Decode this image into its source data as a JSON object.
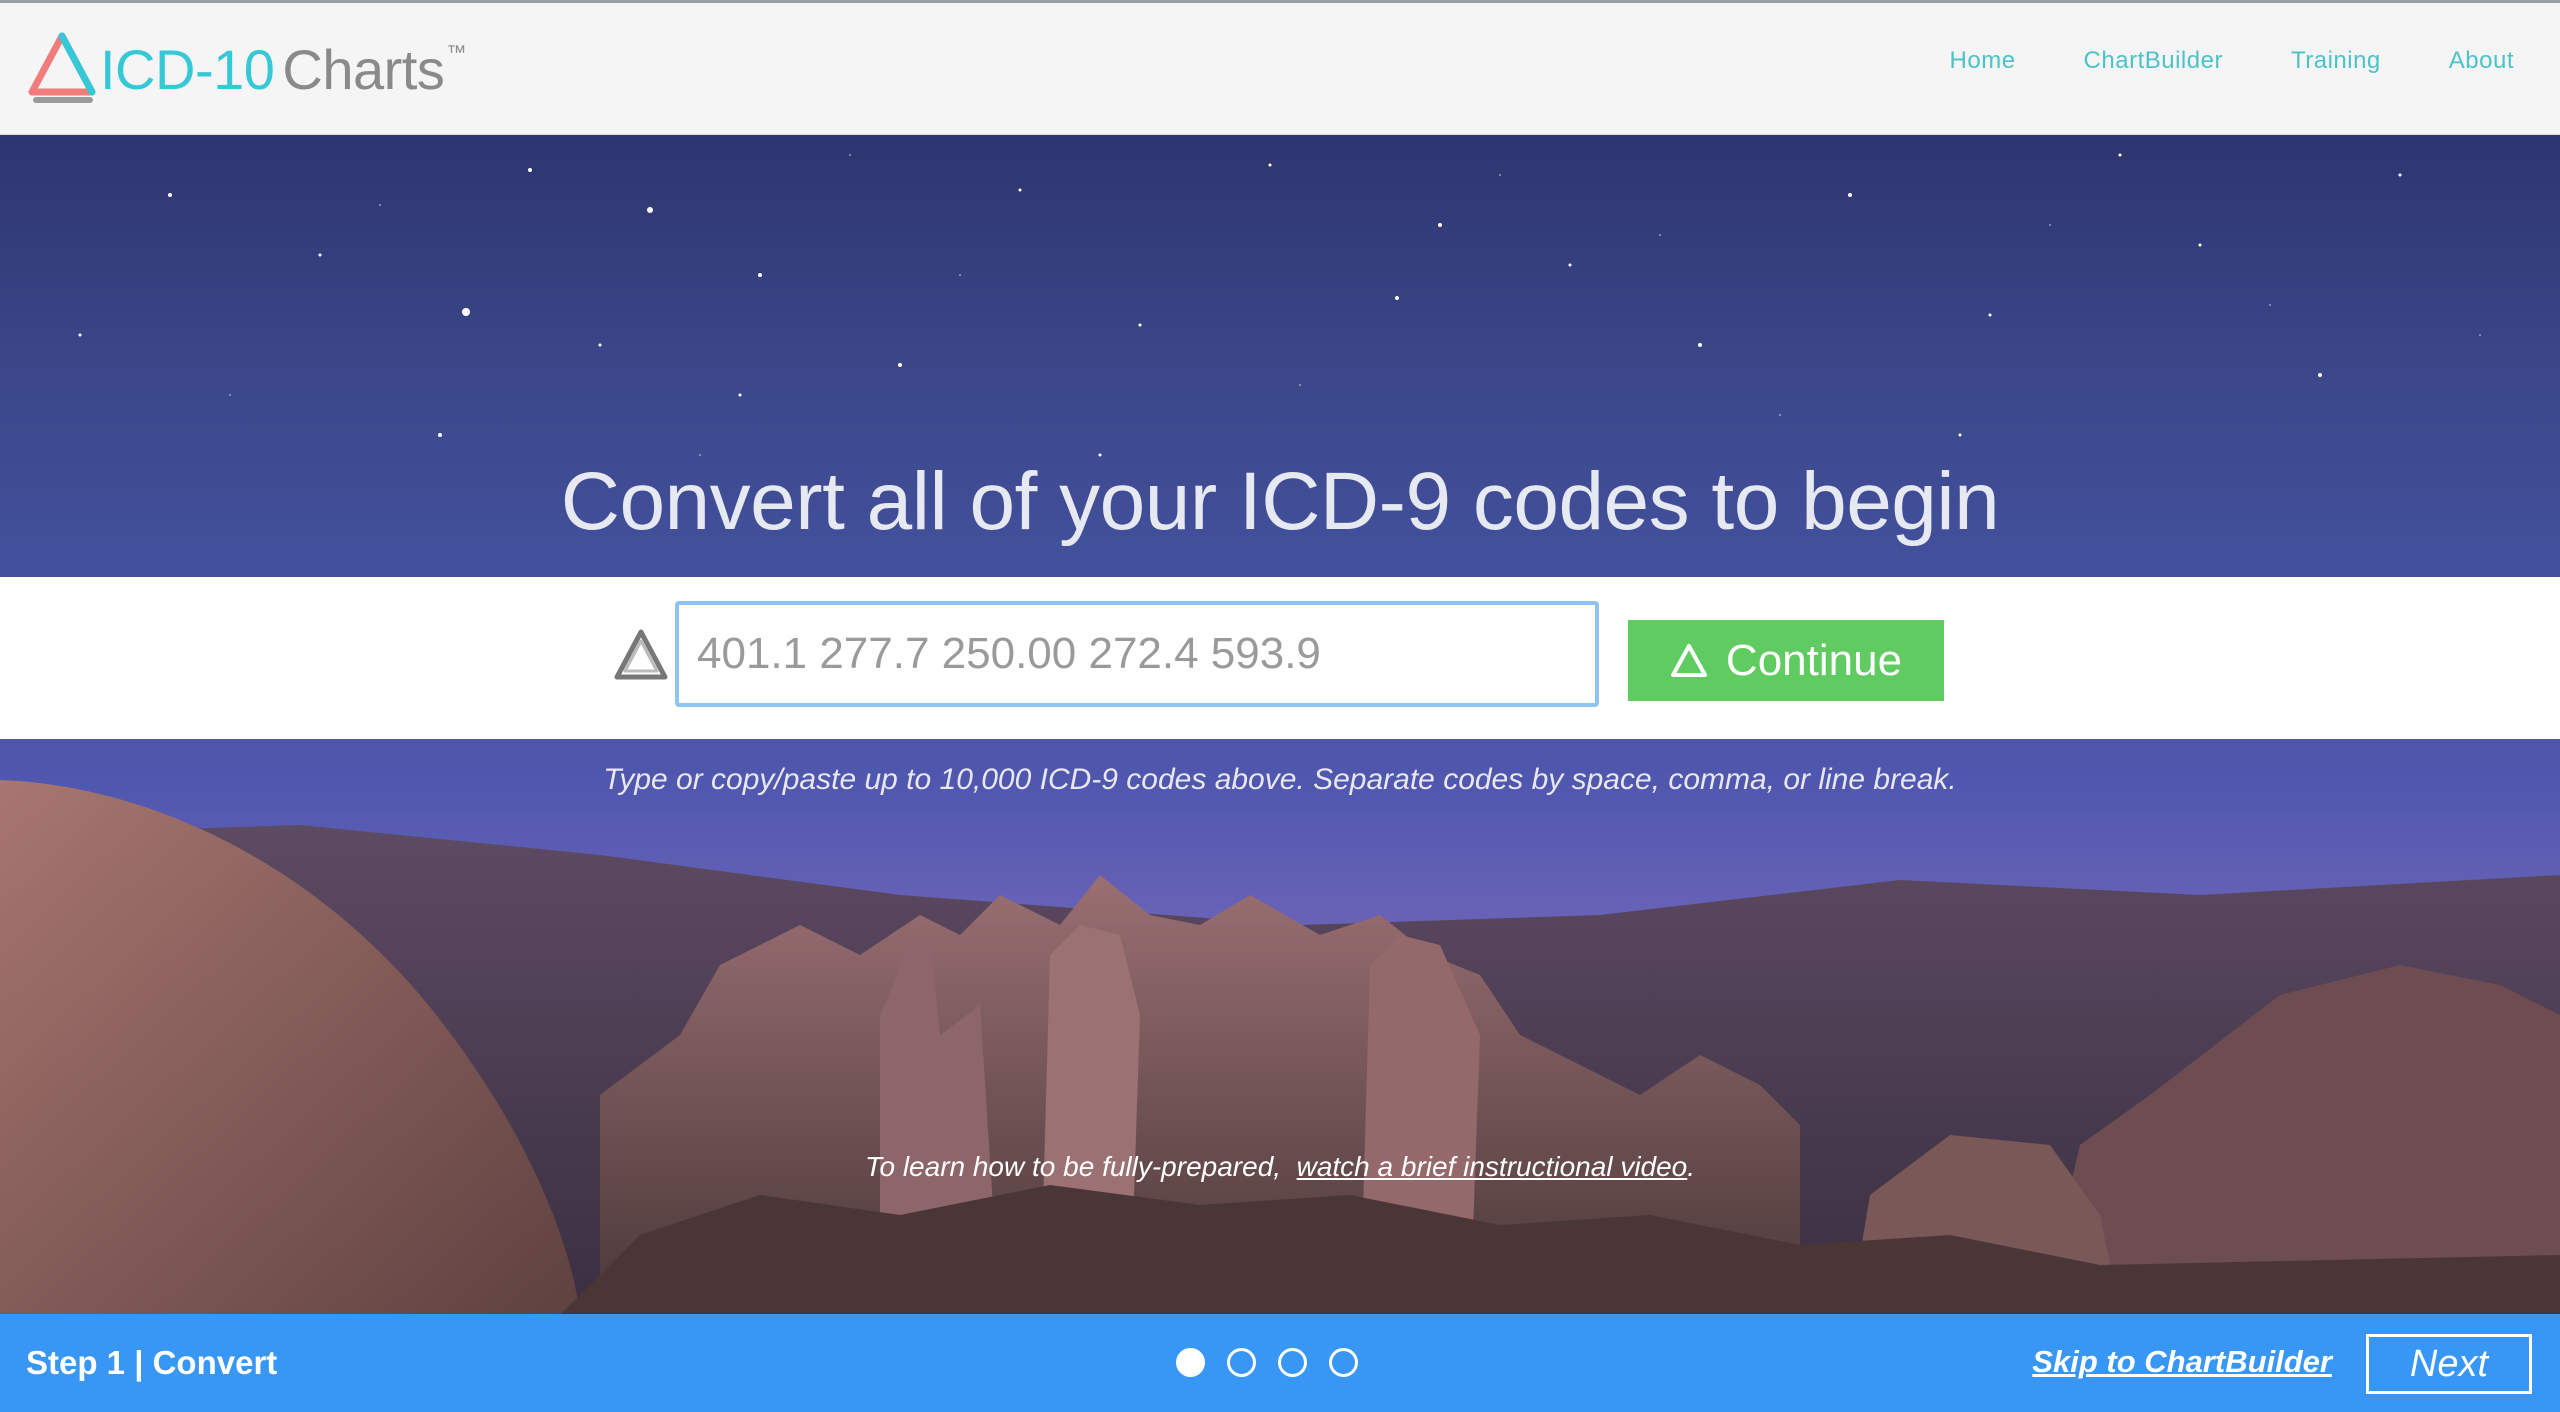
{
  "header": {
    "logo_icd": "ICD-10",
    "logo_charts": "Charts",
    "logo_tm": "™",
    "logo_colors": {
      "teal": "#37c8d7",
      "coral": "#f07c7c",
      "gray": "#9b9b9b"
    },
    "nav": [
      {
        "label": "Home"
      },
      {
        "label": "ChartBuilder"
      },
      {
        "label": "Training"
      },
      {
        "label": "About"
      }
    ]
  },
  "hero": {
    "headline": "Convert all of your ICD-9 codes to begin",
    "input_placeholder": "401.1 277.7 250.00 272.4 593.9",
    "input_value": "",
    "continue_label": "Continue",
    "helper_text": "Type or copy/paste up to 10,000 ICD-9 codes above.  Separate codes by space, comma, or line break.",
    "learn_prefix": "To learn how to be fully-prepared,",
    "learn_link": "watch a brief instructional video",
    "learn_suffix": "."
  },
  "bottom_bar": {
    "step_label": "Step 1 | Convert",
    "steps_total": 4,
    "active_step": 1,
    "skip_label": "Skip to ChartBuilder",
    "next_label": "Next",
    "color": "#3896f5"
  },
  "colors": {
    "continue_green": "#5fcb60",
    "nav_teal": "#4cc3c9",
    "input_border": "#8fc4f2"
  }
}
